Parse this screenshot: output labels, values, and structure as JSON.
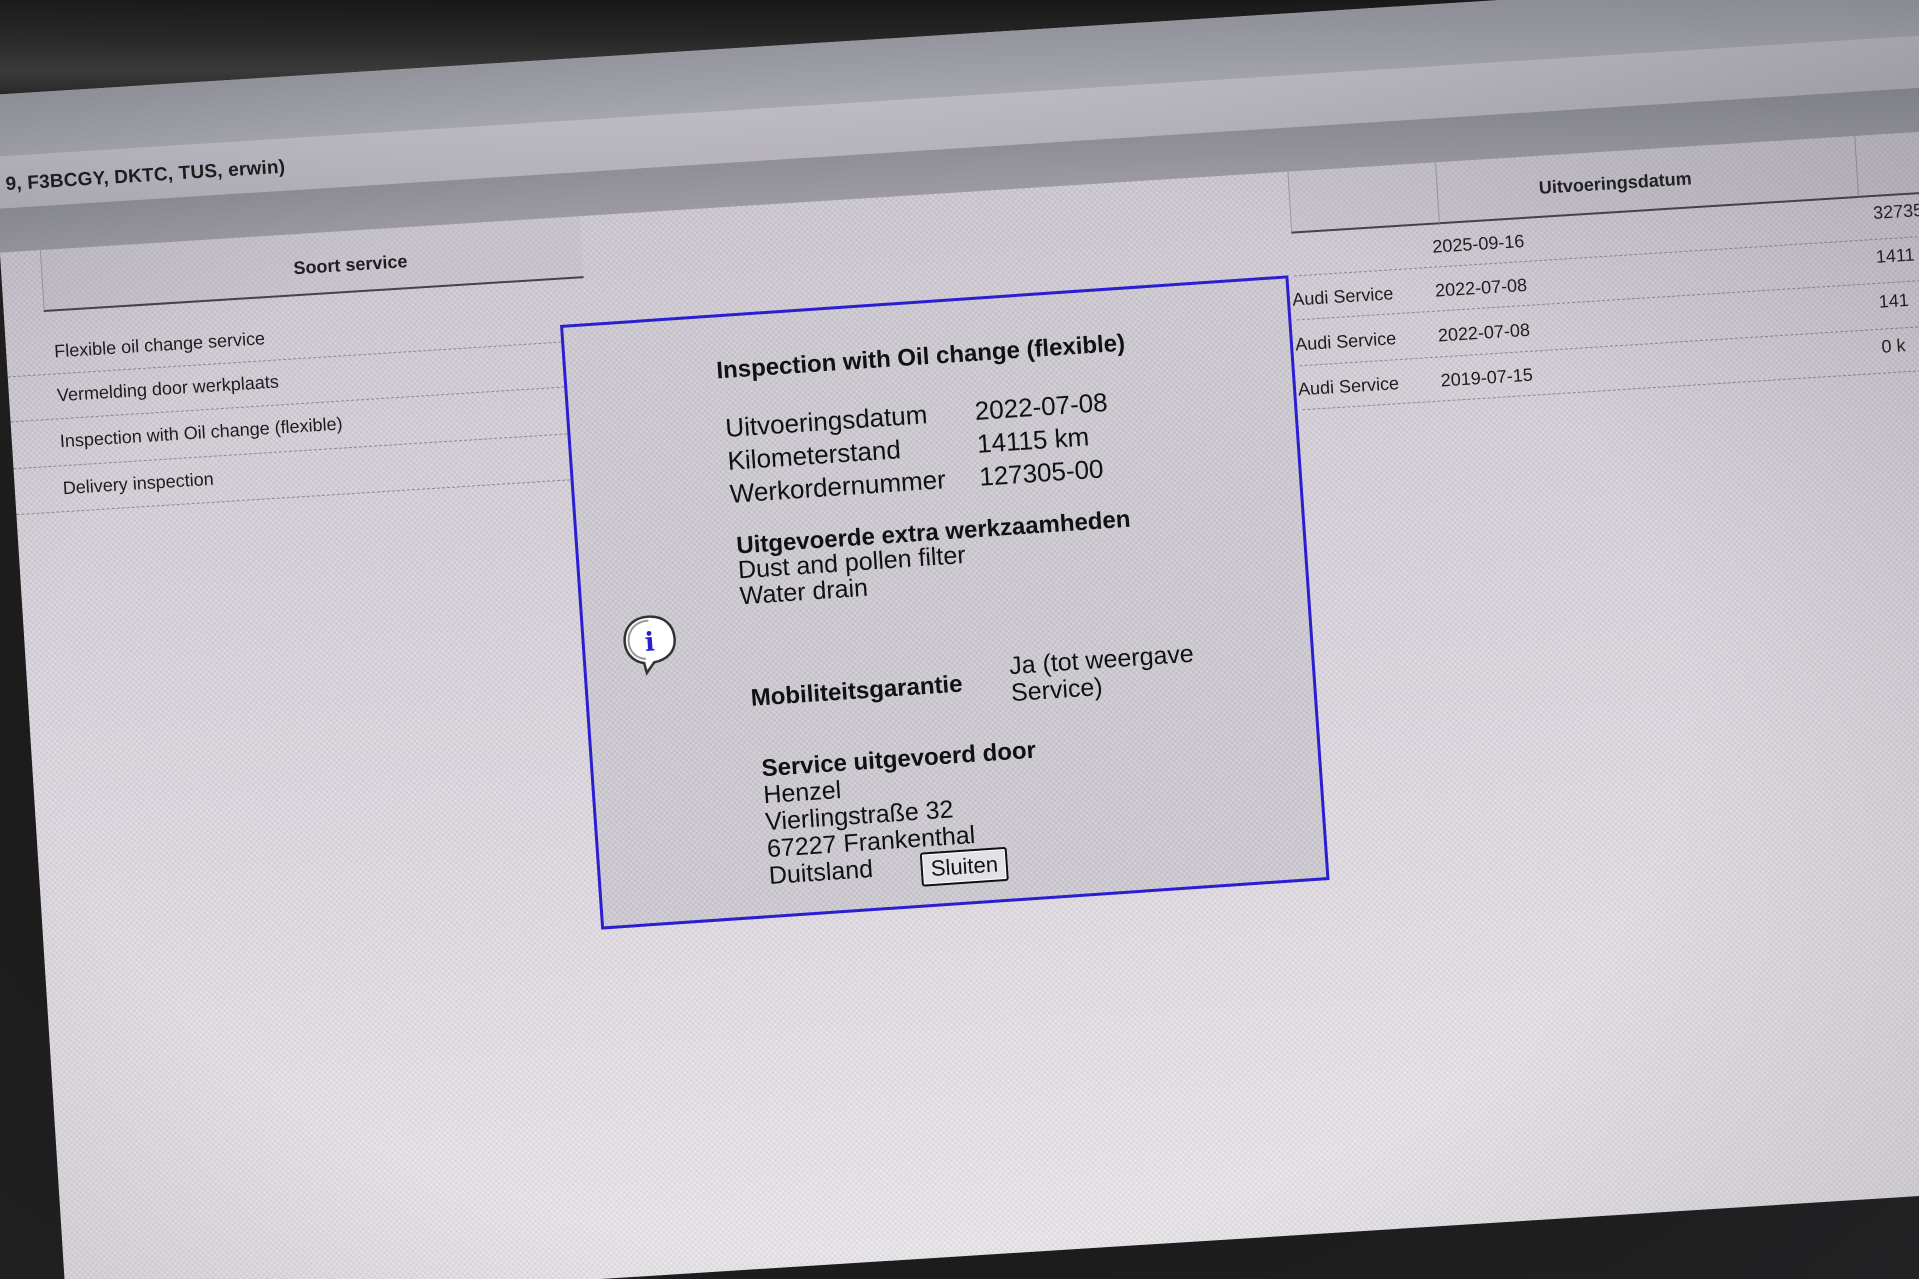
{
  "header": {
    "title": "9, F3BCGY, DKTC, TUS, erwin)"
  },
  "table": {
    "columns": {
      "service_type": "Soort service",
      "execution_date": "Uitvoeringsdatum"
    },
    "left_rows": [
      "Flexible oil change service",
      "Vermelding door werkplaats",
      "Inspection with Oil change (flexible)",
      "Delivery inspection"
    ],
    "right_rows": [
      {
        "provider": "",
        "date": "2025-09-16",
        "km": "32735"
      },
      {
        "provider": "Audi Service",
        "date": "2022-07-08",
        "km": "1411"
      },
      {
        "provider": "Audi Service",
        "date": "2022-07-08",
        "km": "141"
      },
      {
        "provider": "Audi Service",
        "date": "2019-07-15",
        "km": "0 k"
      }
    ]
  },
  "dialog": {
    "title": "Inspection with Oil change (flexible)",
    "fields": [
      {
        "label": "Uitvoeringsdatum",
        "value": "2022-07-08"
      },
      {
        "label": "Kilometerstand",
        "value": "14115 km"
      },
      {
        "label": "Werkordernummer",
        "value": "127305-00"
      }
    ],
    "extra_work": {
      "heading": "Uitgevoerde extra werkzaamheden",
      "items": [
        "Dust and pollen filter",
        "Water drain"
      ]
    },
    "mobility": {
      "label": "Mobiliteitsgarantie",
      "value_line1": "Ja (tot weergave",
      "value_line2": "Service)"
    },
    "performed_by": {
      "heading": "Service uitgevoerd door",
      "lines": [
        "Henzel",
        "Vierlingstraße 32",
        "67227 Frankenthal",
        "Duitsland"
      ]
    },
    "close_label": "Sluiten",
    "info_icon": "info-speech-bubble-icon"
  }
}
